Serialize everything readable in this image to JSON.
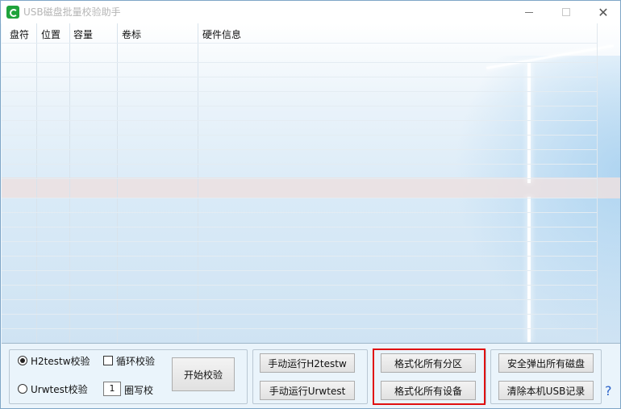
{
  "window": {
    "title": "USB磁盘批量校验助手"
  },
  "columns": [
    "盘符",
    "位置",
    "容量",
    "卷标",
    "硬件信息"
  ],
  "options": {
    "radio_h2testw": "H2testw校验",
    "radio_urwtest": "Urwtest校验",
    "checkbox_loop": "循环校验",
    "loop_count": "1",
    "loop_suffix": "圈写校"
  },
  "buttons": {
    "start": "开始校验",
    "manual_h2testw": "手动运行H2testw",
    "manual_urwtest": "手动运行Urwtest",
    "format_partitions": "格式化所有分区",
    "format_devices": "格式化所有设备",
    "eject_all": "安全弹出所有磁盘",
    "clear_usb": "清除本机USB记录"
  },
  "help": "?",
  "colors": {
    "highlight": "#e01010",
    "accent": "#1fa33b"
  }
}
